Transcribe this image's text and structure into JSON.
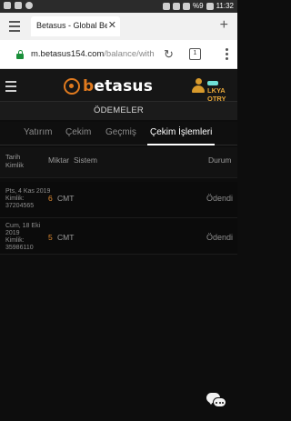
{
  "status_bar": {
    "time": "11:32",
    "battery": "%9",
    "icons": [
      "notification-f-icon",
      "notification-s-icon",
      "phone-icon",
      "image-icon",
      "wifi-icon",
      "signal-icon",
      "battery-icon"
    ]
  },
  "browser": {
    "tab_title": "Betasus - Global Betting",
    "url_host": "m.betasus154.com",
    "url_path": "/balance/withdraw",
    "tab_count": "1"
  },
  "site": {
    "logo_prefix": "b",
    "logo_text": "etasus",
    "user_name_line1": "LKYA",
    "user_name_line2": "OTRY",
    "accent_color": "#e07a1f"
  },
  "page": {
    "title": "ÖDEMELER",
    "tabs": [
      {
        "label": "Yatırım"
      },
      {
        "label": "Çekim"
      },
      {
        "label": "Geçmiş"
      },
      {
        "label": "Çekim İşlemleri"
      }
    ]
  },
  "table": {
    "headers": {
      "date": "Tarih",
      "id": "Kimlik",
      "amount": "Miktar",
      "system": "Sistem",
      "status": "Durum"
    },
    "rows": [
      {
        "date": "Pts, 4 Kas 2019",
        "id_label": "Kimlik:",
        "id_value": "37204565",
        "amount": "6",
        "system": "CMT",
        "status": "Ödendi"
      },
      {
        "date_line1": "Cum, 18 Eki",
        "date_line2": "2019",
        "id_label": "Kimlik:",
        "id_value": "35986110",
        "amount": "5",
        "system": "CMT",
        "status": "Ödendi"
      }
    ]
  }
}
